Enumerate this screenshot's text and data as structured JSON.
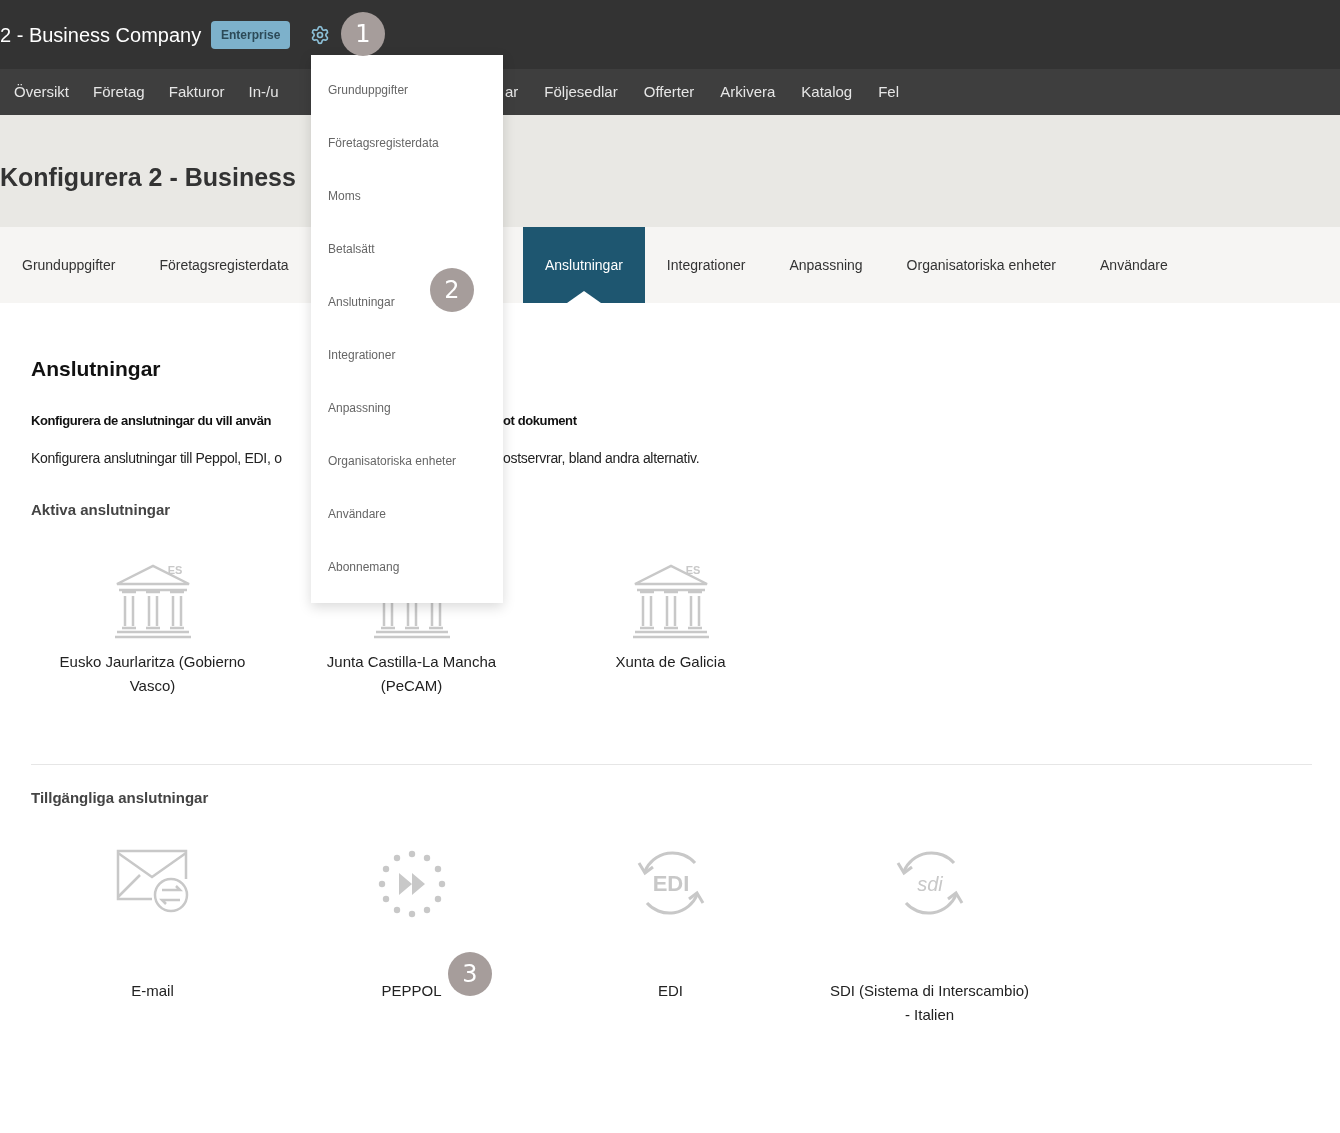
{
  "topbar": {
    "company": "2 - Business Company",
    "badge": "Enterprise"
  },
  "nav": {
    "items": [
      {
        "label": "Översikt"
      },
      {
        "label": "Företag"
      },
      {
        "label": "Fakturor"
      },
      {
        "label": "In-/u"
      }
    ],
    "items_after": [
      {
        "label": "ar"
      },
      {
        "label": "Följesedlar"
      },
      {
        "label": "Offerter"
      },
      {
        "label": "Arkivera"
      },
      {
        "label": "Katalog"
      },
      {
        "label": "Fel"
      }
    ]
  },
  "page_title": "Konfigurera 2 - Business",
  "tabs": {
    "items_before": [
      {
        "label": "Grunduppgifter",
        "selected": false
      },
      {
        "label": "Företagsregisterdata",
        "selected": false
      }
    ],
    "items_after": [
      {
        "label": "Anslutningar",
        "selected": true
      },
      {
        "label": "Integrationer",
        "selected": false
      },
      {
        "label": "Anpassning",
        "selected": false
      },
      {
        "label": "Organisatoriska enheter",
        "selected": false
      },
      {
        "label": "Användare",
        "selected": false
      }
    ]
  },
  "section": {
    "title": "Anslutningar",
    "lead_before": "Konfigurera de anslutningar du vill använ",
    "lead_after": "ot dokument",
    "text_before": "Konfigurera anslutningar till Peppol, EDI, o",
    "text_after": "ostservrar, bland andra alternativ."
  },
  "active": {
    "title": "Aktiva anslutningar",
    "items": [
      {
        "kind": "bank",
        "logo_text": "ES",
        "label": "Eusko Jaurlaritza (Gobierno Vasco)"
      },
      {
        "kind": "bank",
        "label": "Junta Castilla-La Mancha (PeCAM)"
      },
      {
        "kind": "bank",
        "logo_text": "ES",
        "label": "Xunta de Galicia"
      }
    ]
  },
  "available": {
    "title": "Tillgängliga anslutningar",
    "items": [
      {
        "kind": "email",
        "label": "E-mail"
      },
      {
        "kind": "peppol",
        "label": "PEPPOL"
      },
      {
        "kind": "edi",
        "logo_text": "EDI",
        "label": "EDI"
      },
      {
        "kind": "sdi",
        "logo_text": "sdi",
        "label": "SDI (Sistema di Interscambio) - Italien"
      }
    ]
  },
  "settings_menu": {
    "items": [
      {
        "label": "Grunduppgifter"
      },
      {
        "label": "Företagsregisterdata"
      },
      {
        "label": "Moms"
      },
      {
        "label": "Betalsätt"
      },
      {
        "label": "Anslutningar"
      },
      {
        "label": "Integrationer"
      },
      {
        "label": "Anpassning"
      },
      {
        "label": "Organisatoriska enheter"
      },
      {
        "label": "Användare"
      },
      {
        "label": "Abonnemang"
      }
    ]
  },
  "callouts": [
    "1",
    "2",
    "3"
  ]
}
